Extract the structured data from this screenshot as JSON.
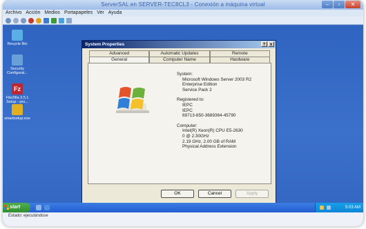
{
  "host_window": {
    "title": "ServerSAL en SERVER-TEC8CL3 - Conexión a máquina virtual",
    "menu": [
      "Archivo",
      "Acción",
      "Medios",
      "Portapapeles",
      "Ver",
      "Ayuda"
    ]
  },
  "desktop_icons": [
    {
      "label": "Recycle Bin",
      "icon": "recycle-bin-icon",
      "color": "#5ab0e6"
    },
    {
      "label": "Security Configurat...",
      "icon": "security-config-icon",
      "color": "#6aa0d8"
    },
    {
      "label": "FileZilla 3.5.1 Setup - pro...",
      "icon": "filezilla-icon",
      "color": "#c0262d"
    },
    {
      "label": "smartsetup.exe",
      "icon": "setup-exe-icon",
      "color": "#e0b020"
    }
  ],
  "dialog": {
    "title": "System Properties",
    "title_buttons": [
      "?",
      "x"
    ],
    "tabs_top": [
      "Advanced",
      "Automatic Updates",
      "Remote"
    ],
    "tabs_bottom": [
      "General",
      "Computer Name",
      "Hardware"
    ],
    "active_tab": "General",
    "system_heading": "System:",
    "system_lines": [
      "Microsoft Windows Server 2003 R2",
      "Enterprise Edition",
      "Service Pack 2"
    ],
    "registered_heading": "Registered to:",
    "registered_lines": [
      "IEPC",
      "IEPC",
      "69713-650-3689364-45790"
    ],
    "computer_heading": "Computer:",
    "computer_lines": [
      "Intel(R) Xeon(R) CPU E5-2630",
      "0 @ 2.30GHz",
      "2.19 GHz, 2.00 GB of RAM",
      "Physical Address Extension"
    ],
    "buttons": {
      "ok": "OK",
      "cancel": "Cancel",
      "apply": "Apply"
    }
  },
  "taskbar": {
    "start_label": "start",
    "clock": "5:03 AM"
  },
  "status_bar": {
    "text": "Estado: ejecutándose"
  },
  "colors": {
    "desktop_blue": "#3468c3",
    "dialog_title": "#0a246a",
    "taskbar_blue": "#245ed2",
    "start_green": "#2f8d2f"
  }
}
